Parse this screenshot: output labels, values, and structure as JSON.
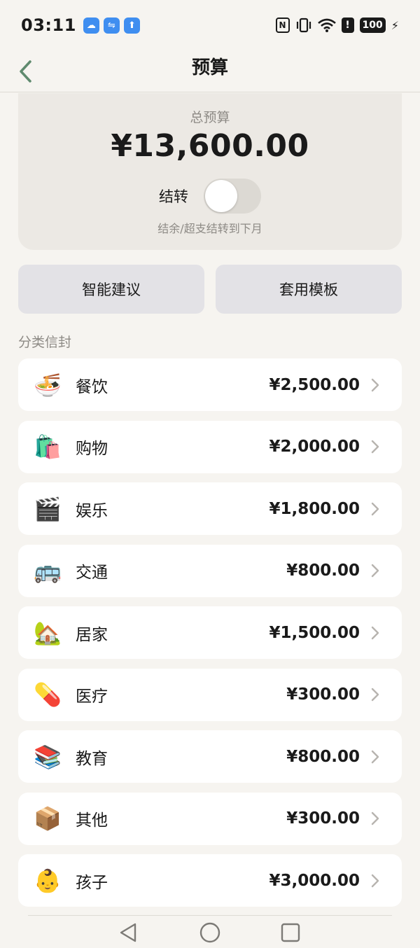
{
  "status_bar": {
    "time": "03:11",
    "battery": "100",
    "app_icons": [
      "weather-icon",
      "usb-icon",
      "upload-icon"
    ],
    "system_icons": [
      "nfc-icon",
      "vibrate-icon",
      "wifi-icon",
      "alert-icon",
      "battery-icon",
      "charging-icon"
    ]
  },
  "header": {
    "title": "预算"
  },
  "budget": {
    "label": "总预算",
    "amount": "¥13,600.00",
    "carryover_label": "结转",
    "carryover_enabled": false,
    "carryover_hint": "结余/超支结转到下月"
  },
  "actions": {
    "suggest_label": "智能建议",
    "template_label": "套用模板"
  },
  "envelopes": {
    "section_title": "分类信封",
    "items": [
      {
        "icon": "🍜",
        "icon_name": "noodle-bowl-icon",
        "name": "餐饮",
        "amount": "¥2,500.00"
      },
      {
        "icon": "🛍️",
        "icon_name": "shopping-bags-icon",
        "name": "购物",
        "amount": "¥2,000.00"
      },
      {
        "icon": "🎬",
        "icon_name": "clapperboard-icon",
        "name": "娱乐",
        "amount": "¥1,800.00"
      },
      {
        "icon": "🚌",
        "icon_name": "bus-icon",
        "name": "交通",
        "amount": "¥800.00"
      },
      {
        "icon": "🏡",
        "icon_name": "house-icon",
        "name": "居家",
        "amount": "¥1,500.00"
      },
      {
        "icon": "💊",
        "icon_name": "pill-icon",
        "name": "医疗",
        "amount": "¥300.00"
      },
      {
        "icon": "📚",
        "icon_name": "books-icon",
        "name": "教育",
        "amount": "¥800.00"
      },
      {
        "icon": "📦",
        "icon_name": "package-icon",
        "name": "其他",
        "amount": "¥300.00"
      },
      {
        "icon": "👶",
        "icon_name": "baby-icon",
        "name": "孩子",
        "amount": "¥3,000.00"
      }
    ]
  },
  "colors": {
    "background": "#f6f4f0",
    "card": "#ece9e4",
    "button": "#e3e2e6",
    "accent_back": "#5f8a6e",
    "muted_text": "#8d8a85"
  }
}
